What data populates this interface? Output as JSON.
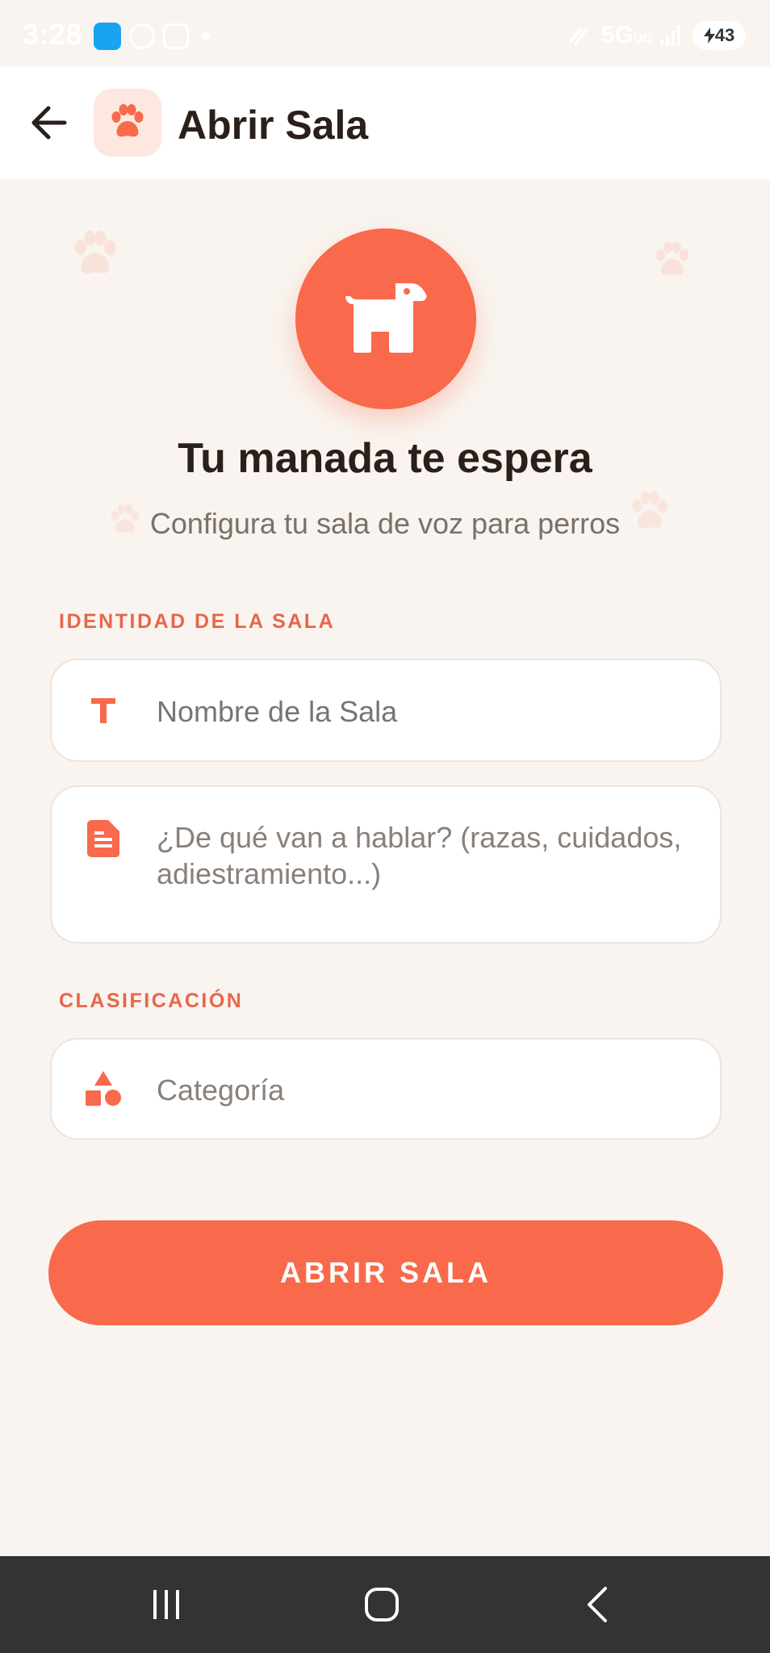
{
  "status_bar": {
    "time": "3:28",
    "network": "5G",
    "network_sub": "UC",
    "battery": "43"
  },
  "header": {
    "title": "Abrir Sala",
    "back_icon": "arrow-left-icon",
    "logo_icon": "paw-icon"
  },
  "hero": {
    "icon": "dog-icon",
    "title": "Tu manada te espera",
    "subtitle": "Configura tu sala de voz para perros"
  },
  "sections": {
    "identity_label": "IDENTIDAD DE LA SALA",
    "classification_label": "CLASIFICACIÓN"
  },
  "fields": {
    "room_name": {
      "placeholder": "Nombre de la Sala",
      "value": "",
      "icon": "text-format-icon"
    },
    "description": {
      "placeholder": "¿De qué van a hablar? (razas, cuidados, adiestramiento...)",
      "value": "",
      "icon": "document-icon"
    },
    "category": {
      "placeholder": "Categoría",
      "value": "",
      "icon": "category-shapes-icon"
    }
  },
  "actions": {
    "open_room_label": "ABRIR SALA"
  },
  "nav": {
    "recents": "recents-icon",
    "home": "home-icon",
    "back": "back-chevron-icon"
  },
  "colors": {
    "accent": "#f9694b",
    "background": "#f9f4ef",
    "label": "#e8664a",
    "title": "#2a1f1a"
  }
}
